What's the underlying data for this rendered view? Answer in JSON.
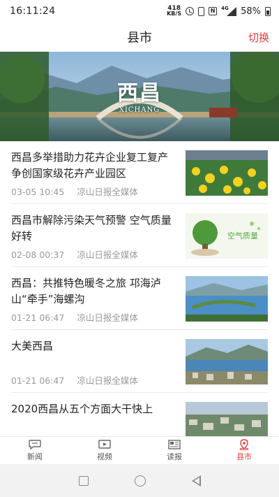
{
  "status_bar": {
    "time": "16:11:24",
    "net_speed_value": "418",
    "net_speed_unit": "KB/S",
    "network_type": "4G",
    "battery": "58%"
  },
  "header": {
    "title": "县市",
    "switch_label": "切换"
  },
  "banner": {
    "caption": "西昌",
    "subcaption": "XICHANG"
  },
  "news": [
    {
      "title": "西昌多举措助力花卉企业复工复产 争创国家级花卉产业园区",
      "date": "03-05",
      "time": "10:45",
      "source": "凉山日报全媒体",
      "thumb": "flowers"
    },
    {
      "title": "西昌市解除污染天气预警 空气质量好转",
      "date": "02-08",
      "time": "00:37",
      "source": "凉山日报全媒体",
      "thumb": "air",
      "thumb_text": "空气质量"
    },
    {
      "title": "西昌：共推特色暖冬之旅 邛海泸山“牵手”海螺沟",
      "date": "01-21",
      "time": "06:47",
      "source": "凉山日报全媒体",
      "thumb": "lake"
    },
    {
      "title": "大美西昌",
      "date": "01-21",
      "time": "06:47",
      "source": "凉山日报全媒体",
      "thumb": "city"
    },
    {
      "title": "2020西昌从五个方面大干快上",
      "date": "",
      "time": "",
      "source": "",
      "thumb": "aerial"
    }
  ],
  "tabs": [
    {
      "label": "新闻",
      "icon": "chat-icon",
      "active": false
    },
    {
      "label": "视频",
      "icon": "video-icon",
      "active": false
    },
    {
      "label": "读报",
      "icon": "newspaper-icon",
      "active": false
    },
    {
      "label": "县市",
      "icon": "location-icon",
      "active": true
    }
  ],
  "colors": {
    "accent": "#e23b3b",
    "meta_text": "#9a9a9a"
  }
}
